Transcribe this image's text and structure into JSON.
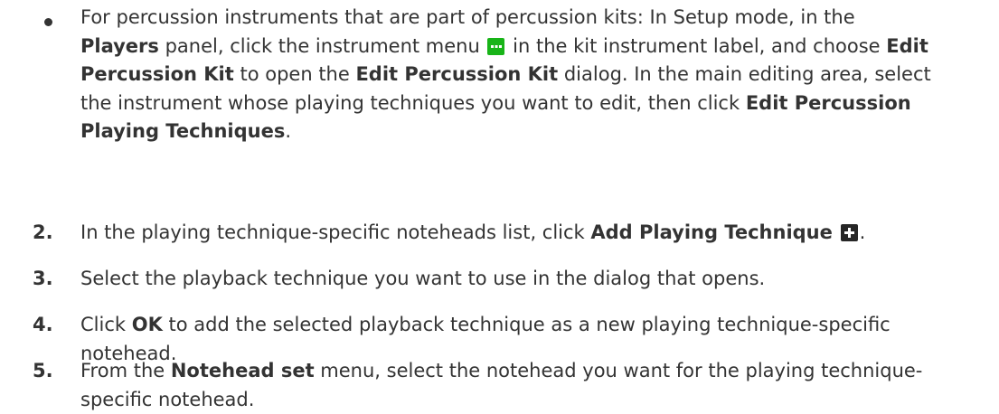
{
  "bullet": {
    "t1": "For percussion instruments that are part of percussion kits: In Setup mode, in the",
    "b1": "Players",
    "t2": " panel, click the instrument menu ",
    "icon1": "more-menu-icon",
    "t3": " in the kit instrument label, and choose ",
    "b2": "Edit Percussion Kit",
    "t4": " to open the ",
    "b3": "Edit Percussion Kit",
    "t5": " dialog. In the main editing area, select the instrument whose playing techniques you want to edit, then click ",
    "b4": "Edit Percussion Playing Techniques",
    "t6": "."
  },
  "steps": [
    {
      "number": "2.",
      "t1": "In the playing technique-specific noteheads list, click ",
      "b1": "Add Playing Technique",
      "icon": "add-icon",
      "t2": "."
    },
    {
      "number": "3.",
      "t1": "Select the playback technique you want to use in the dialog that opens."
    },
    {
      "number": "4.",
      "t1": "Click ",
      "b1": "OK",
      "t2": " to add the selected playback technique as a new playing technique-specific notehead."
    },
    {
      "number": "5.",
      "t1": "From the ",
      "b1": "Notehead set",
      "t2": " menu, select the notehead you want for the playing technique-specific notehead."
    }
  ],
  "colors": {
    "text": "#333333",
    "menu_icon_bg": "#18b418",
    "plus_icon_bg": "#262626"
  }
}
